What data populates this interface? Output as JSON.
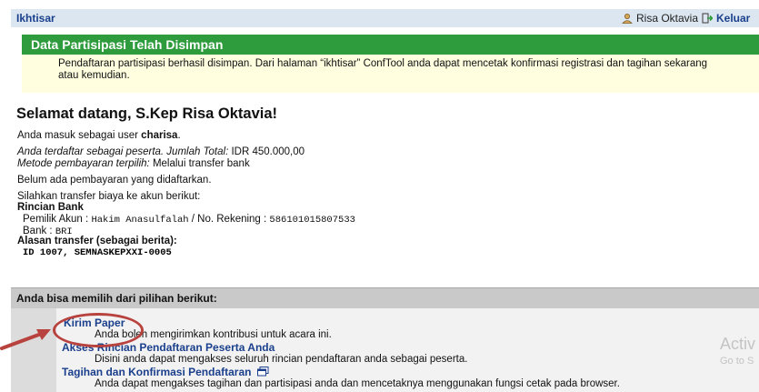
{
  "topbar": {
    "breadcrumb": "Ikhtisar",
    "user_name": "Risa Oktavia",
    "logout_label": "Keluar"
  },
  "notice": {
    "title": "Data Partisipasi Telah Disimpan",
    "message": "Pendaftaran partisipasi berhasil disimpan. Dari halaman “ikhtisar” ConfTool anda dapat mencetak konfirmasi registrasi dan tagihan sekarang atau kemudian."
  },
  "welcome": {
    "title": "Selamat datang, S.Kep Risa Oktavia!",
    "login_prefix": "Anda masuk sebagai user ",
    "username": "charisa",
    "login_suffix": ".",
    "registered_label": "Anda terdaftar sebagai peserta. Jumlah Total:",
    "total": "IDR 450.000,00",
    "method_label": "Metode pembayaran terpilih:",
    "method_value": "Melalui transfer bank",
    "no_payment": "Belum ada pembayaran yang didaftarkan."
  },
  "bank": {
    "instruction": "Silahkan transfer biaya ke akun berikut:",
    "details_title": "Rincian Bank",
    "owner_label": "Pemilik Akun :",
    "owner_value": "Hakim Anasulfalah",
    "account_label": " / No. Rekening :",
    "account_value": "586101015807533",
    "bank_label": "Bank :",
    "bank_value": "BRI",
    "reason_title": "Alasan transfer (sebagai berita):",
    "reason_value": "ID 1007, SEMNASKEPXXI-0005"
  },
  "choices": {
    "heading": "Anda bisa memilih dari pilihan berikut:",
    "items": [
      {
        "label": "Kirim Paper",
        "desc": "Anda boleh mengirimkan kontribusi untuk acara ini."
      },
      {
        "label": "Akses Rincian Pendaftaran Peserta Anda",
        "desc": "Disini anda dapat mengakses seluruh rincian pendaftaran anda sebagai peserta."
      },
      {
        "label": "Tagihan dan Konfirmasi Pendaftaran",
        "desc": "Anda dapat mengakses tagihan dan partisipasi anda dan mencetaknya menggunakan fungsi cetak pada browser."
      }
    ]
  },
  "watermark": {
    "line1": "Activ",
    "line2": "Go to S"
  },
  "colors": {
    "header_green": "#2e9c3c",
    "link_blue": "#1a3f8c",
    "annotation_red": "#b8423d"
  }
}
